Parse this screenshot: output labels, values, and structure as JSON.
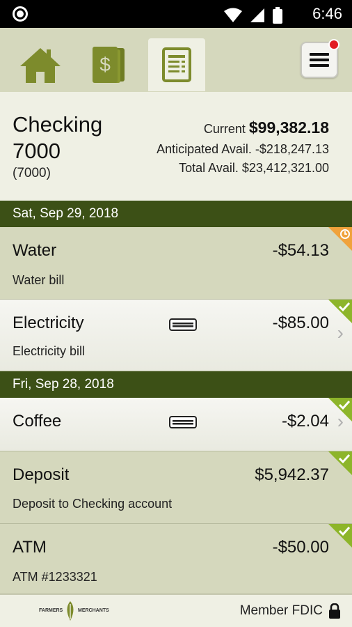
{
  "status_bar": {
    "time": "6:46"
  },
  "nav": {
    "tabs": [
      {
        "name": "home"
      },
      {
        "name": "accounts"
      },
      {
        "name": "transactions",
        "active": true
      }
    ]
  },
  "account": {
    "name": "Checking 7000",
    "number": "(7000)",
    "current_label": "Current",
    "current_value": "$99,382.18",
    "anticipated_label": "Anticipated Avail.",
    "anticipated_value": "-$218,247.13",
    "total_label": "Total Avail.",
    "total_value": "$23,412,321.00"
  },
  "groups": [
    {
      "date": "Sat, Sep 29, 2018",
      "transactions": [
        {
          "name": "Water",
          "description": "Water bill",
          "amount": "-$54.13",
          "status": "pending"
        },
        {
          "name": "Electricity",
          "description": "Electricity bill",
          "amount": "-$85.00",
          "status": "cleared"
        }
      ]
    },
    {
      "date": "Fri, Sep 28, 2018",
      "transactions": [
        {
          "name": "Coffee",
          "description": "",
          "amount": "-$2.04",
          "status": "cleared"
        },
        {
          "name": "Deposit",
          "description": "Deposit to Checking account",
          "amount": "$5,942.37",
          "status": "cleared"
        },
        {
          "name": "ATM",
          "description": "ATM #1233321",
          "amount": "-$50.00",
          "status": "cleared"
        }
      ]
    }
  ],
  "footer": {
    "logo_left": "FARMERS",
    "logo_right": "MERCHANTS",
    "fdic": "Member FDIC"
  },
  "colors": {
    "accent_green": "#7d8b2c",
    "header_green": "#3c5016",
    "check_green": "#8db52a",
    "pending_orange": "#f0a23c"
  }
}
